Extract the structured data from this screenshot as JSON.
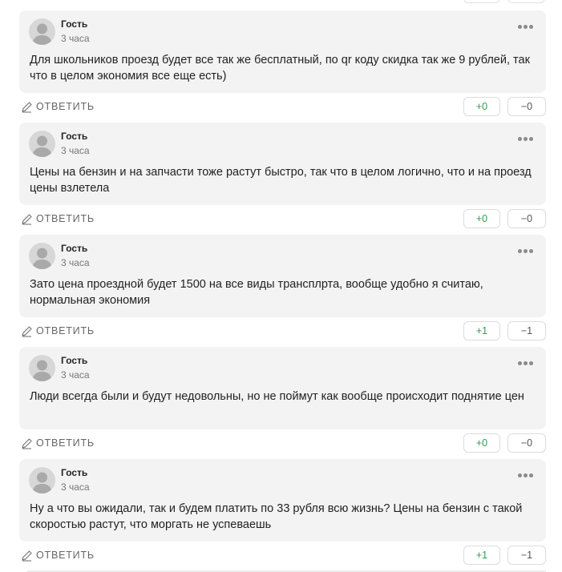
{
  "reply_label": "ОТВЕТИТЬ",
  "colors": {
    "card_bg": "#f3f3f3",
    "upvote": "#2e9e4f",
    "downvote": "#555555",
    "avatar": "#d7d7d7"
  },
  "icons": {
    "reply": "pencil-icon",
    "menu": "more-dots-icon",
    "avatar": "user-silhouette-icon"
  },
  "comments": [
    {
      "author": "Гость",
      "time": "3 часа",
      "text": "Для школьников проезд будет все так же бесплатный, по qr коду скидка так же 9 рублей, так что в целом экономия все еще есть)",
      "up": "+0",
      "down": "−0"
    },
    {
      "author": "Гость",
      "time": "3 часа",
      "text": "Цены на бензин и на запчасти тоже растут быстро, так что в целом логично, что и на проезд цены взлетела",
      "up": "+0",
      "down": "−0"
    },
    {
      "author": "Гость",
      "time": "3 часа",
      "text": "Зато цена проездной будет 1500 на все виды трансплрта, вообще удобно я считаю, нормальная экономия",
      "up": "+1",
      "down": "−1"
    },
    {
      "author": "Гость",
      "time": "3 часа",
      "text": "Люди всегда были и будут недовольны, но не поймут как вообще происходит поднятие цен",
      "up": "+0",
      "down": "−0"
    },
    {
      "author": "Гость",
      "time": "3 часа",
      "text": "Ну а что вы ожидали, так и будем платить по 33 рубля всю жизнь? Цены на бензин с такой скоростью растут, что моргать не успеваешь",
      "up": "+1",
      "down": "−1"
    }
  ]
}
